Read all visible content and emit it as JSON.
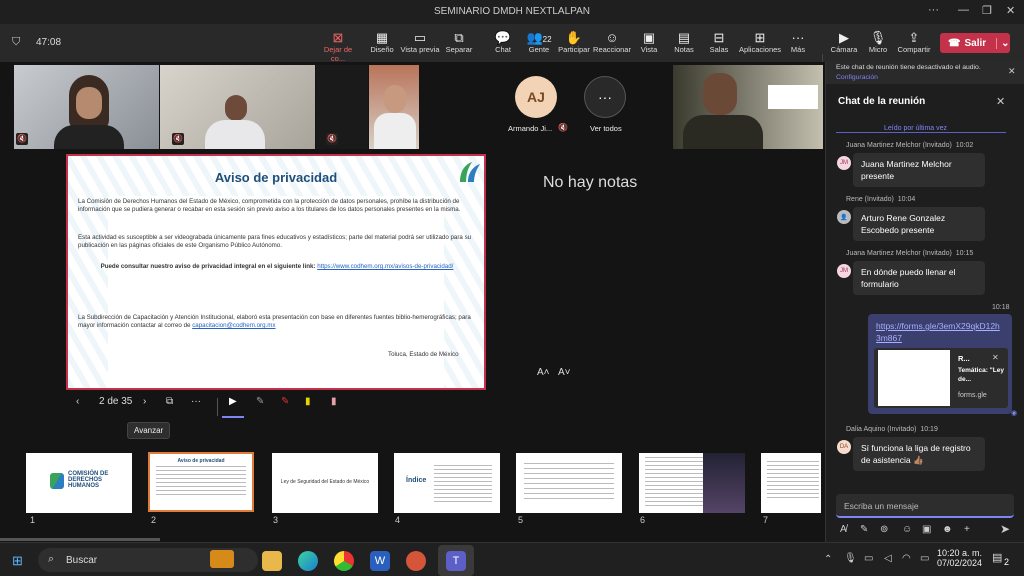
{
  "window": {
    "title": "SEMINARIO DMDH NEXTLALPAN"
  },
  "toolbar": {
    "timer": "47:08",
    "items": [
      {
        "label": "Dejar de co...",
        "icon": "stop-share-icon"
      },
      {
        "label": "Diseño",
        "icon": "layout-icon"
      },
      {
        "label": "Vista previa",
        "icon": "preview-icon"
      },
      {
        "label": "Separar",
        "icon": "popout-icon"
      },
      {
        "label": "Chat",
        "icon": "chat-icon"
      },
      {
        "label": "Gente",
        "icon": "people-icon",
        "count": "22"
      },
      {
        "label": "Participar",
        "icon": "raise-hand-icon"
      },
      {
        "label": "Reaccionar",
        "icon": "react-icon"
      },
      {
        "label": "Vista",
        "icon": "view-icon"
      },
      {
        "label": "Notas",
        "icon": "notes-icon"
      },
      {
        "label": "Salas",
        "icon": "rooms-icon"
      },
      {
        "label": "Aplicaciones",
        "icon": "apps-icon"
      },
      {
        "label": "Más",
        "icon": "more-icon"
      },
      {
        "label": "Cámara",
        "icon": "camera-icon"
      },
      {
        "label": "Micro",
        "icon": "mic-icon"
      },
      {
        "label": "Compartir",
        "icon": "share-icon"
      }
    ],
    "leave": "Salir"
  },
  "participants": {
    "aj_initials": "AJ",
    "aj_name": "Armando Ji...",
    "see_all": "Ver todos"
  },
  "stage": {
    "no_notes": "No hay notas"
  },
  "slide": {
    "title": "Aviso de privacidad",
    "p1": "La Comisión de Derechos Humanos del Estado de México, comprometida con la protección de datos personales, prohíbe la distribución de información que se pudiera generar o recabar en esta sesión sin previo aviso a los titulares de los datos personales presentes en la misma.",
    "p2": "Esta actividad es susceptible a ser videograbada únicamente para fines educativos y estadísticos; parte del material podrá ser utilizado para su publicación en las páginas oficiales de este Organismo Público Autónomo.",
    "p3": "Puede consultar nuestro aviso de privacidad integral en el siguiente link:",
    "p3_link": "https://www.codhem.org.mx/avisos-de-privacidad/",
    "p4": "La Subdirección de Capacitación y Atención Institucional, elaboró esta presentación con base en diferentes fuentes biblio-hemerográficas; para mayor información contactar al correo de",
    "p4_link": "capacitacion@codhem.org.mx",
    "place": "Toluca, Estado de México"
  },
  "slide_controls": {
    "page": "2 de 35",
    "tooltip": "Avanzar",
    "font_up": "A˄",
    "font_down": "A˅"
  },
  "thumbnails": [
    {
      "num": "1",
      "text": "COMISIÓN DE DERECHOS HUMANOS"
    },
    {
      "num": "2",
      "text": "Aviso de privacidad"
    },
    {
      "num": "3",
      "text": "Ley de Seguridad del Estado de México"
    },
    {
      "num": "4",
      "text": "Índice"
    },
    {
      "num": "5",
      "text": ""
    },
    {
      "num": "6",
      "text": "Introducción"
    },
    {
      "num": "7",
      "text": ""
    }
  ],
  "chat": {
    "banner": "Este chat de reunión tiene desactivado el audio.",
    "banner_link": "Configuración",
    "title": "Chat de la reunión",
    "read_marker": "Leído por última vez",
    "messages": [
      {
        "author": "Juana Martinez Melchor (Invitado)",
        "time": "10:02",
        "text": "Juana Martinez Melchor presente",
        "initials": "JM"
      },
      {
        "author": "Rene (Invitado)",
        "time": "10:04",
        "text": "Arturo Rene Gonzalez Escobedo presente",
        "initials": ""
      },
      {
        "author": "Juana Martinez Melchor (Invitado)",
        "time": "10:15",
        "text": "En dónde puedo llenar el formulario",
        "initials": "JM"
      }
    ],
    "own_time": "10:18",
    "own_link": "https://forms.gle/3emX29qkD12h3m867",
    "card_title": "R...",
    "card_sub": "Temática: \"Ley de...",
    "card_domain": "forms.gle",
    "last_author": "Dalia Aquino (Invitado)",
    "last_time": "10:19",
    "last_initials": "DA",
    "last_text": "Sí funciona la liga de registro de asistencia 👍🏽",
    "input_placeholder": "Escriba un mensaje"
  },
  "taskbar": {
    "search": "Buscar",
    "time": "10:20 a. m.",
    "date": "07/02/2024",
    "notif": "2"
  }
}
